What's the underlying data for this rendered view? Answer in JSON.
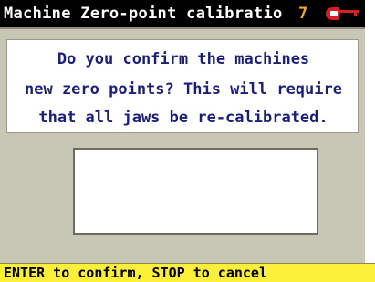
{
  "window": {
    "title": "Machine Zero-point calibratio",
    "number": "7",
    "logo_icon": "silca-key-logo-icon"
  },
  "dialog": {
    "lines": [
      "Do you confirm the machines",
      "new zero points? This will require",
      "that all jaws be re-calibrated."
    ]
  },
  "status_bar": {
    "text": "ENTER to confirm, STOP to cancel"
  },
  "colors": {
    "title_bg": "#000000",
    "screen_bg": "#c8c7b6",
    "message_text": "#1b1f78",
    "status_bg": "#fbef3a",
    "number_color": "#f5a623",
    "logo_red": "#d81f26"
  }
}
